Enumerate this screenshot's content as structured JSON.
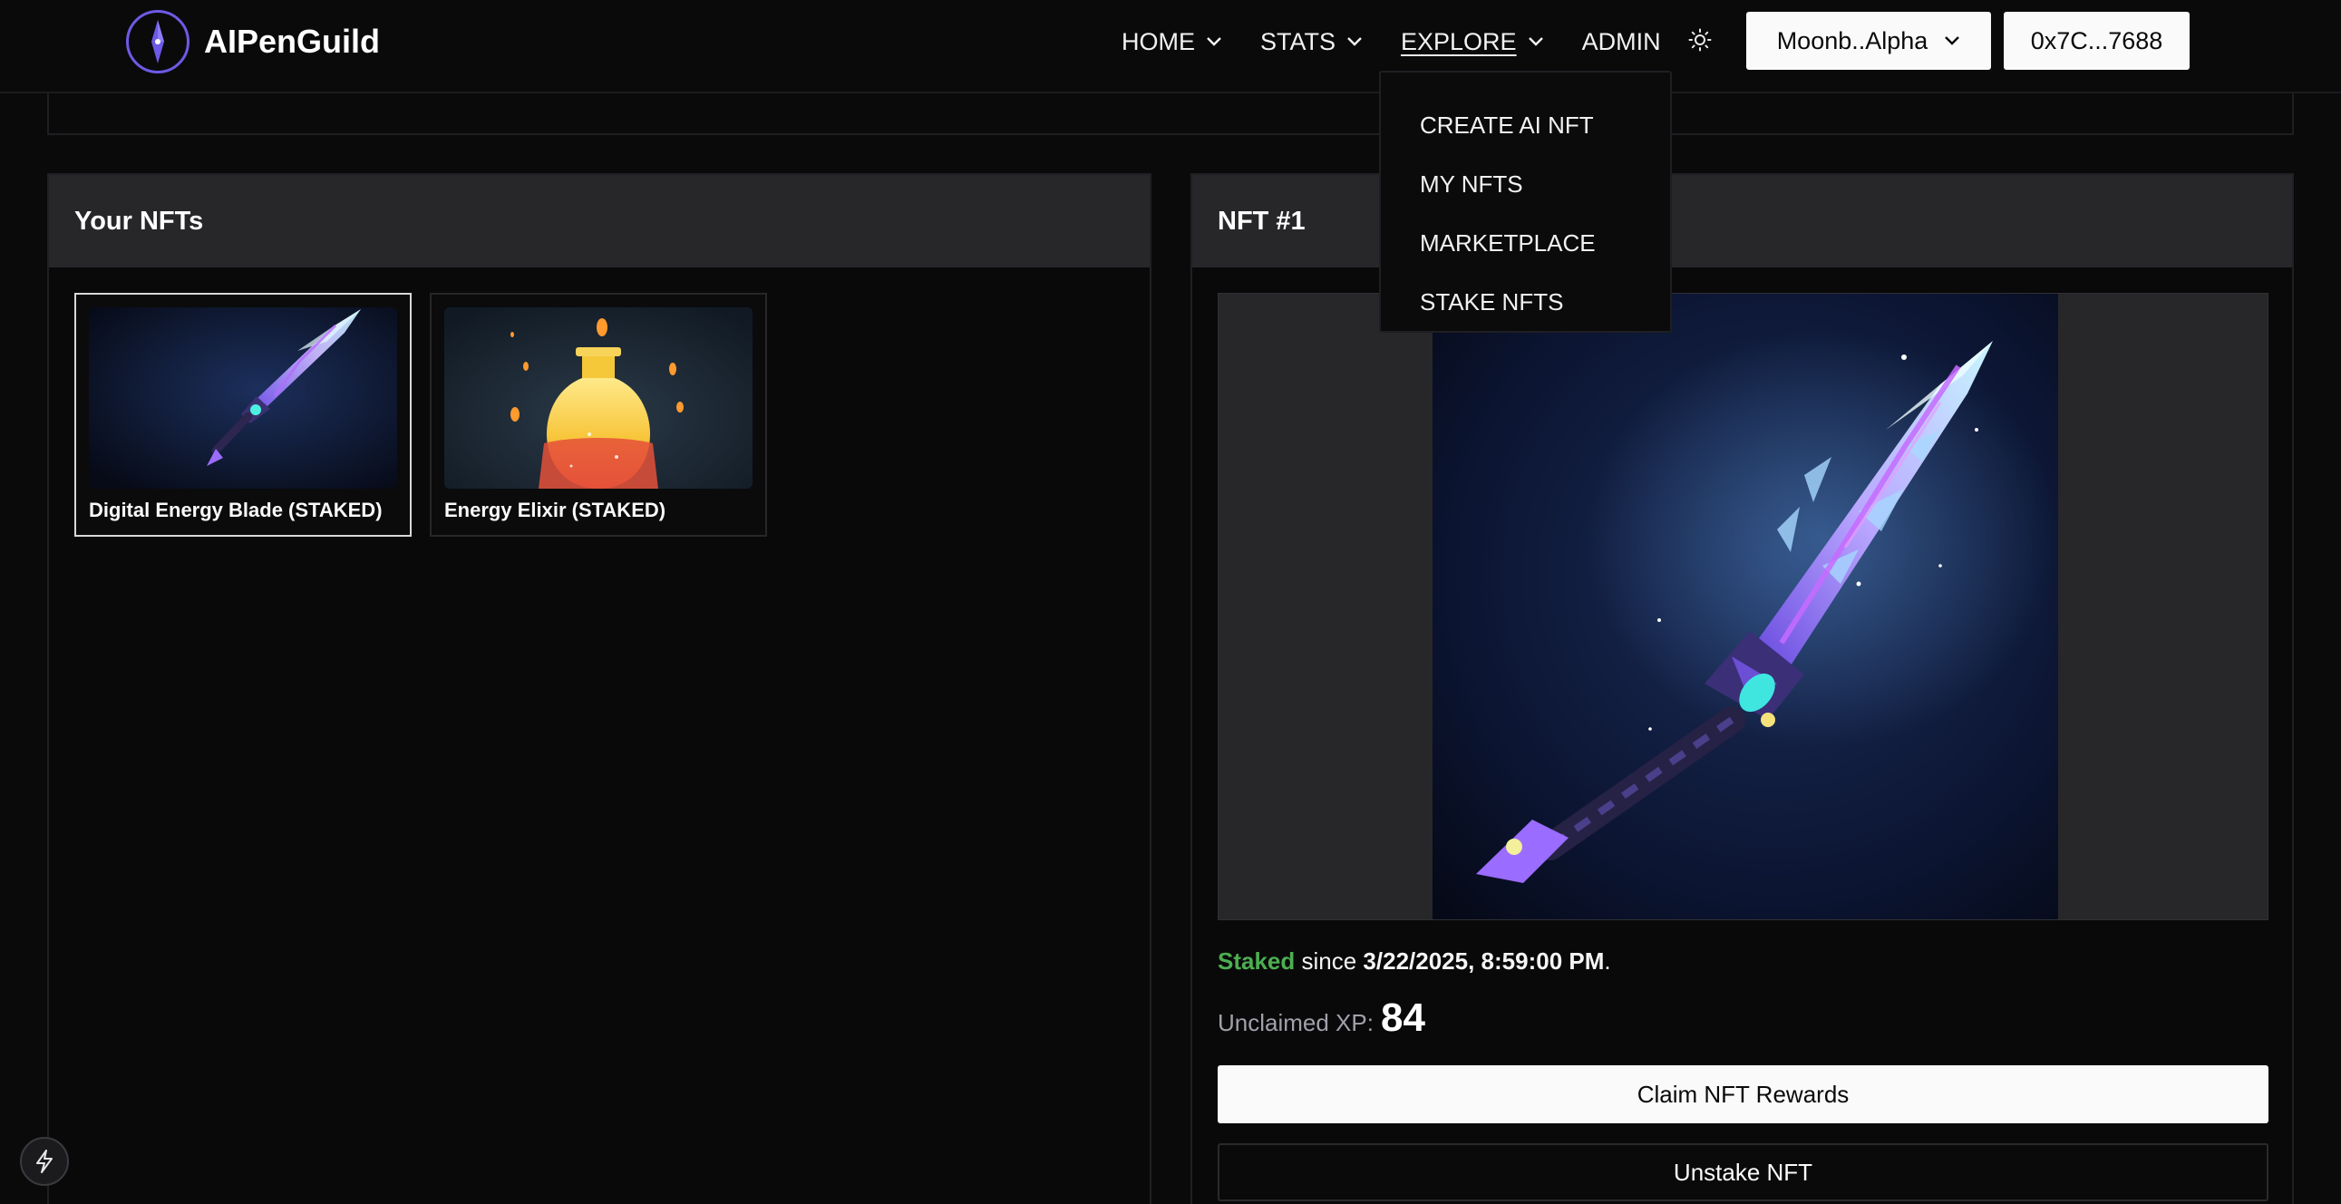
{
  "brand": {
    "name": "AIPenGuild",
    "accent": "#6d5ae6"
  },
  "nav": {
    "items": [
      {
        "label": "HOME",
        "has_dropdown": true
      },
      {
        "label": "STATS",
        "has_dropdown": true
      },
      {
        "label": "EXPLORE",
        "has_dropdown": true,
        "active": true
      },
      {
        "label": "ADMIN",
        "has_dropdown": false
      }
    ],
    "theme_icon": "sun-icon",
    "network_label": "Moonb..Alpha",
    "wallet_label": "0x7C...7688"
  },
  "explore_menu": {
    "items": [
      "CREATE AI NFT",
      "MY NFTS",
      "MARKETPLACE",
      "STAKE NFTS"
    ]
  },
  "your_nfts": {
    "title": "Your NFTs",
    "items": [
      {
        "caption": "Digital Energy Blade (STAKED)",
        "image": "energy-blade-art",
        "selected": true
      },
      {
        "caption": "Energy Elixir (STAKED)",
        "image": "energy-elixir-art",
        "selected": false
      }
    ]
  },
  "detail": {
    "title": "NFT #1",
    "image": "energy-blade-art",
    "status_word": "Staked",
    "since_text": " since ",
    "since_date": "3/22/2025, 8:59:00 PM",
    "period": ".",
    "xp_label": "Unclaimed XP:",
    "xp_value": "84",
    "claim_label": "Claim NFT Rewards",
    "unstake_label": "Unstake NFT"
  },
  "colors": {
    "background": "#0a0a0b",
    "panel_header": "#27272a",
    "staked_green": "#4caf50",
    "button_light": "#fafafa"
  },
  "floating_icon": "bolt-icon"
}
